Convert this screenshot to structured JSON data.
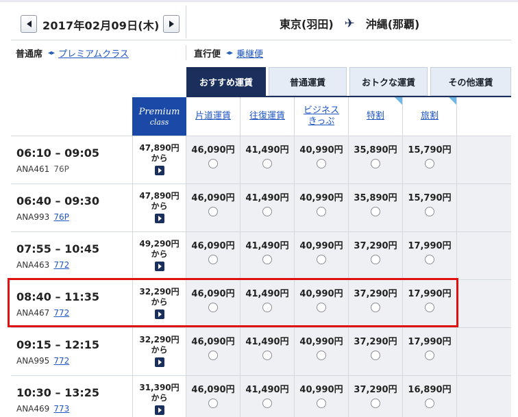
{
  "date_nav": {
    "date": "2017年02月09日(木)",
    "prev": "prev",
    "next": "next"
  },
  "route": {
    "from": "東京(羽田)",
    "to": "沖縄(那覇)",
    "icon": "airplane-icon"
  },
  "seat_class": {
    "current": "普通席",
    "alternate": "プレミアムクラス"
  },
  "flight_type": {
    "current": "直行便",
    "alternate": "乗継便"
  },
  "tabs": [
    "おすすめ運賃",
    "普通運賃",
    "おトクな運賃",
    "その他運賃"
  ],
  "premium_header": {
    "line1": "Premium",
    "line2": "class"
  },
  "fare_headers": [
    {
      "label": "片道運賃"
    },
    {
      "label": "往復運賃"
    },
    {
      "label": "ビジネス\nきっぷ"
    },
    {
      "label": "特割"
    },
    {
      "label": "旅割"
    }
  ],
  "flights": [
    {
      "times": "06:10 – 09:05",
      "flight": "ANA461",
      "equipment": "76P",
      "equipment_link": false,
      "premium": "47,890円",
      "kara": "から",
      "fares": [
        "46,090円",
        "41,490円",
        "40,990円",
        "35,890円",
        "15,790円"
      ]
    },
    {
      "times": "06:40 – 09:30",
      "flight": "ANA993",
      "equipment": "76P",
      "equipment_link": true,
      "premium": "47,890円",
      "kara": "から",
      "fares": [
        "46,090円",
        "41,490円",
        "40,990円",
        "35,890円",
        "15,790円"
      ]
    },
    {
      "times": "07:55 – 10:45",
      "flight": "ANA463",
      "equipment": "772",
      "equipment_link": true,
      "premium": "49,290円",
      "kara": "から",
      "fares": [
        "46,090円",
        "41,490円",
        "40,990円",
        "37,290円",
        "17,990円"
      ]
    },
    {
      "times": "08:40 – 11:35",
      "flight": "ANA467",
      "equipment": "772",
      "equipment_link": true,
      "premium": "32,290円",
      "kara": "から",
      "fares": [
        "46,090円",
        "41,490円",
        "40,990円",
        "37,290円",
        "17,990円"
      ]
    },
    {
      "times": "09:15 – 12:15",
      "flight": "ANA995",
      "equipment": "772",
      "equipment_link": true,
      "premium": "32,290円",
      "kara": "から",
      "fares": [
        "46,090円",
        "41,490円",
        "40,990円",
        "37,290円",
        "17,990円"
      ]
    },
    {
      "times": "10:30 – 13:25",
      "flight": "ANA469",
      "equipment": "773",
      "equipment_link": true,
      "premium": "31,390円",
      "kara": "から",
      "fares": [
        "46,090円",
        "41,490円",
        "40,990円",
        "37,290円",
        "16,890円"
      ]
    }
  ],
  "highlight_row": 3,
  "colors": {
    "navy": "#1b2f5c",
    "premium_blue": "#1a49a8",
    "link": "#1f56c4",
    "highlight": "#e01010",
    "corner": "#6fb7e5"
  }
}
